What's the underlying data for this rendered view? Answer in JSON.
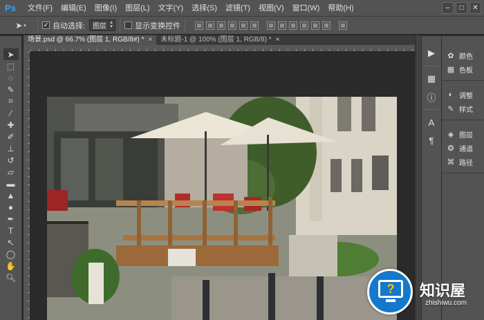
{
  "app": {
    "logo": "Ps"
  },
  "menu": [
    "文件(F)",
    "编辑(E)",
    "图像(I)",
    "图层(L)",
    "文字(Y)",
    "选择(S)",
    "滤镜(T)",
    "视图(V)",
    "窗口(W)",
    "帮助(H)"
  ],
  "window_controls": {
    "minimize": "–",
    "restore": "□",
    "close": "✕"
  },
  "options": {
    "tool_icon": "move-tool-icon",
    "auto_select_checked": true,
    "auto_select_label": "自动选择:",
    "auto_select_value": "图层",
    "transform_checked": false,
    "transform_label": "显示变换控件"
  },
  "tabs": [
    {
      "label": "场景.psd @ 66.7% (图层 1, RGB/8#) *",
      "close": "×",
      "active": true
    },
    {
      "label": "未标题-1 @ 100% (图层 1, RGB/8) *",
      "close": "×",
      "active": false
    }
  ],
  "tools": [
    "move-tool-icon",
    "marquee-tool-icon",
    "lasso-tool-icon",
    "quick-select-icon",
    "crop-tool-icon",
    "eyedropper-icon",
    "healing-brush-icon",
    "brush-tool-icon",
    "clone-stamp-icon",
    "history-brush-icon",
    "eraser-icon",
    "gradient-icon",
    "blur-tool-icon",
    "dodge-tool-icon",
    "pen-tool-icon",
    "type-tool-icon",
    "path-select-icon",
    "shape-tool-icon",
    "hand-tool-icon",
    "zoom-tool-icon"
  ],
  "right_icons": [
    "play-icon",
    "history-icon",
    "info-icon",
    "character-icon",
    "paragraph-icon"
  ],
  "panels": [
    {
      "group": [
        {
          "icon": "color-icon",
          "label": "颜色"
        },
        {
          "icon": "swatches-icon",
          "label": "色板"
        }
      ]
    },
    {
      "group": [
        {
          "icon": "adjustments-icon",
          "label": "调整"
        },
        {
          "icon": "styles-icon",
          "label": "样式"
        }
      ]
    },
    {
      "group": [
        {
          "icon": "layers-icon",
          "label": "图层"
        },
        {
          "icon": "channels-icon",
          "label": "通道"
        },
        {
          "icon": "paths-icon",
          "label": "路径"
        }
      ]
    }
  ],
  "watermark": {
    "title": "知识屋",
    "subtitle": "zhishiwu.com"
  },
  "colors": {
    "chrome": "#535353",
    "workspace": "#282828",
    "accent": "#1478cc",
    "watermark_icon": "#ffc400"
  }
}
